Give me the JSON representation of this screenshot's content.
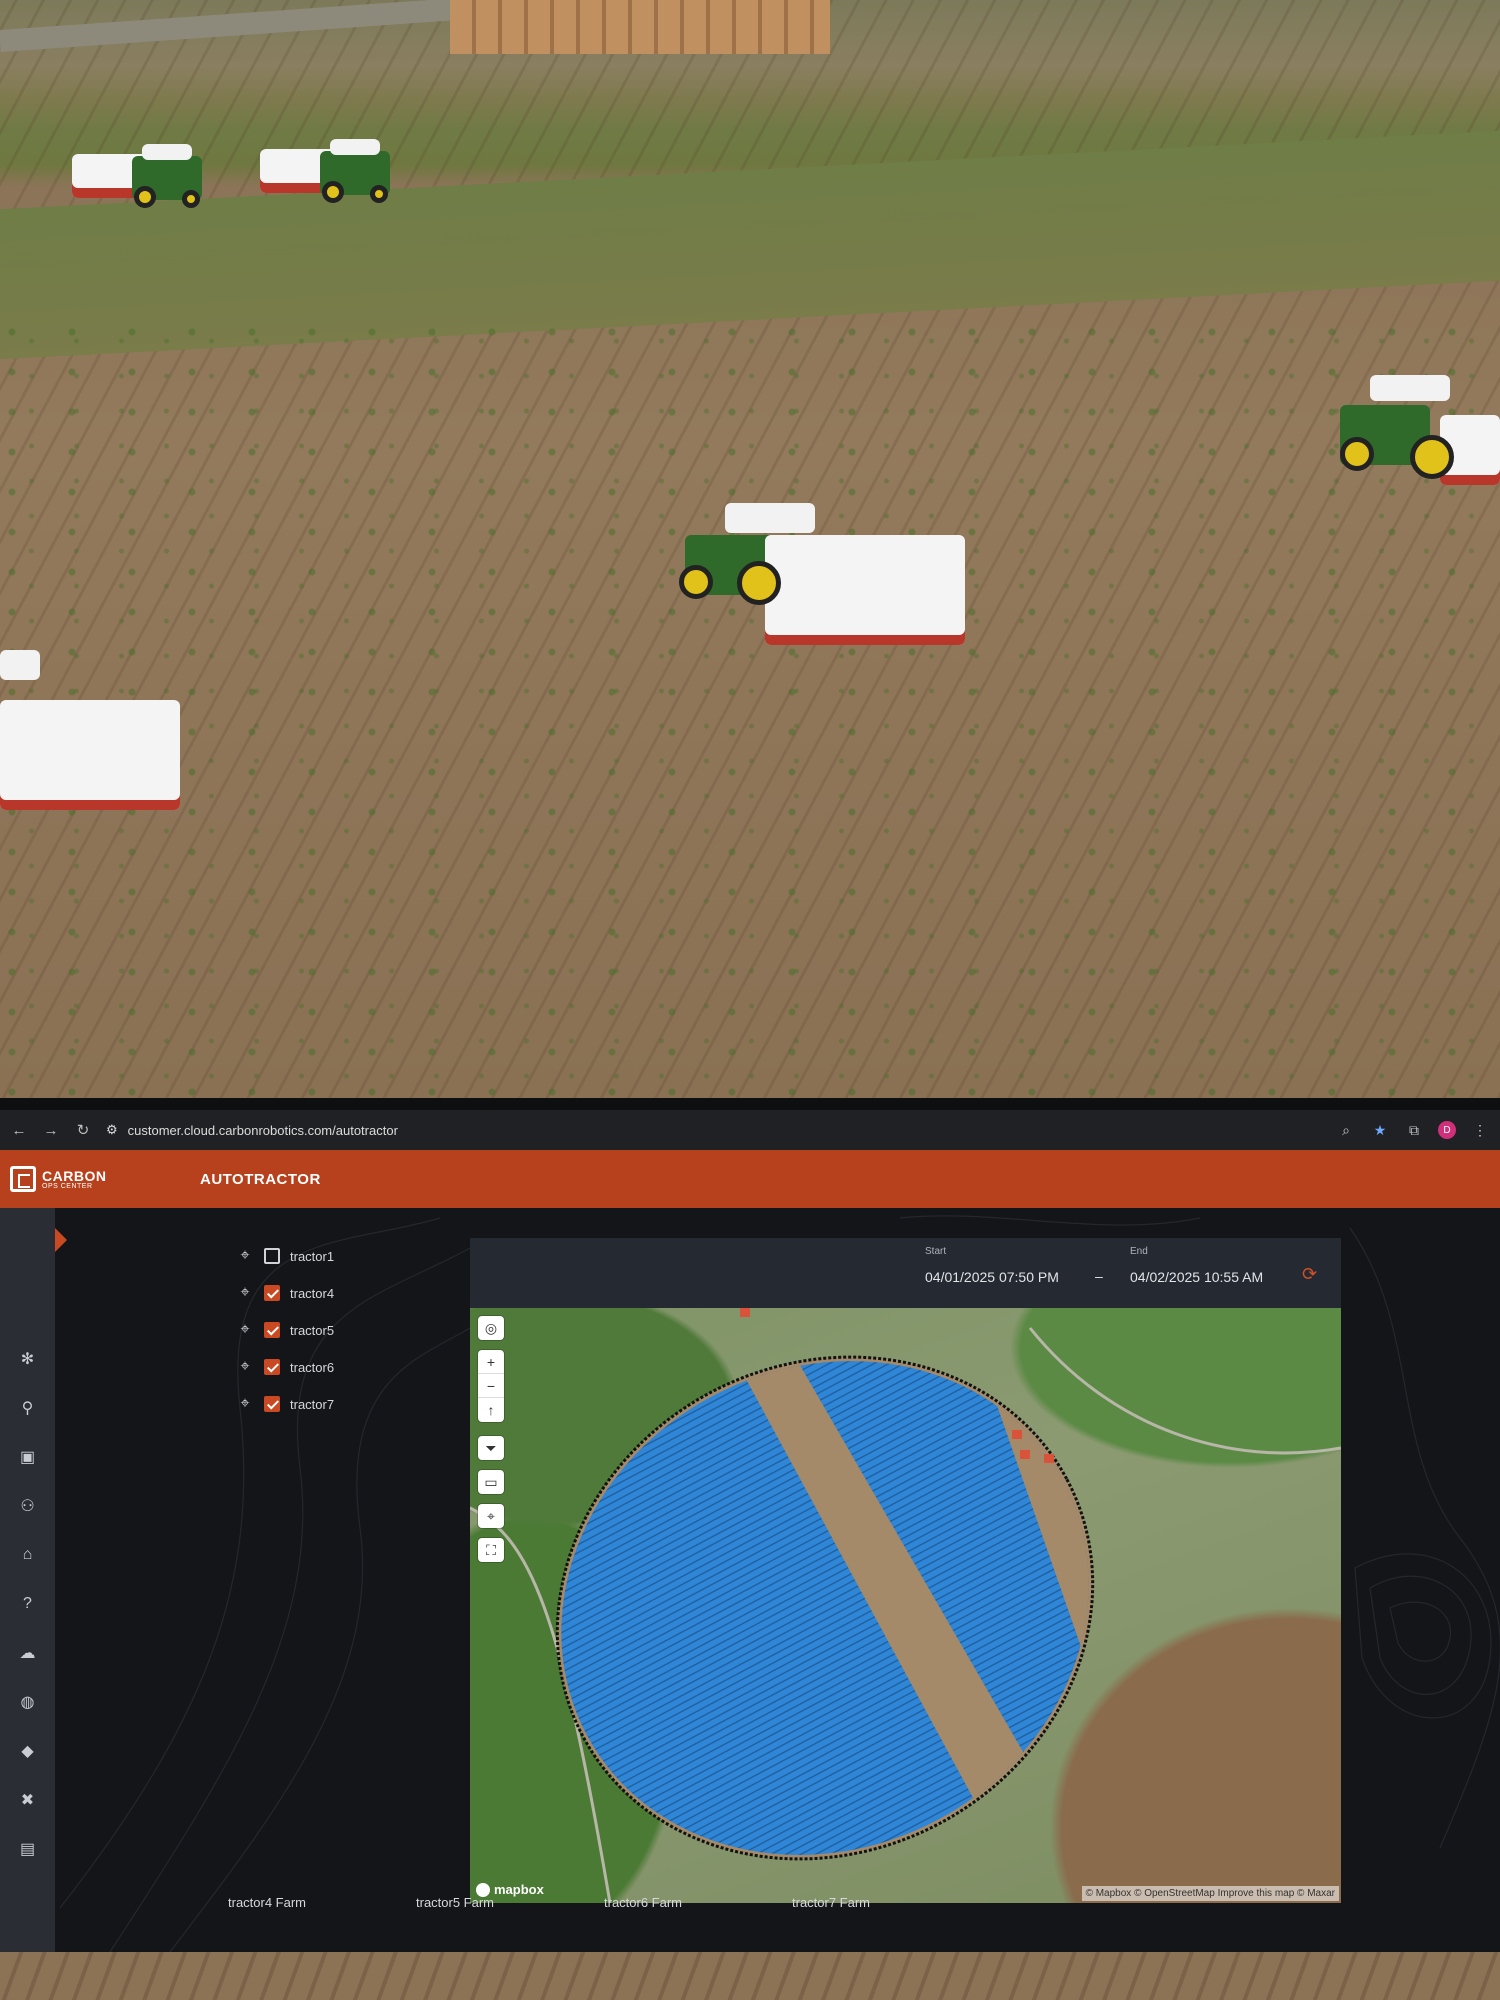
{
  "browser": {
    "url": "customer.cloud.carbonrobotics.com/autotractor",
    "profile_initial": "D"
  },
  "header": {
    "logo_line1": "CARBON",
    "logo_line2": "OPS CENTER",
    "title": "AUTOTRACTOR",
    "color": "#b8411d"
  },
  "sidebar": {
    "icons": [
      "settings-icon",
      "route-icon",
      "image-icon",
      "group-icon",
      "garage-icon",
      "help-icon",
      "cloud-upload-icon",
      "globe-icon",
      "diamond-icon",
      "tools-icon",
      "feedback-icon"
    ]
  },
  "tractors": [
    {
      "label": "tractor1",
      "checked": false
    },
    {
      "label": "tractor4",
      "checked": true
    },
    {
      "label": "tractor5",
      "checked": true
    },
    {
      "label": "tractor6",
      "checked": true
    },
    {
      "label": "tractor7",
      "checked": true
    }
  ],
  "date_range": {
    "start_label": "Start",
    "start_value": "04/01/2025 07:50 PM",
    "separator": "–",
    "end_label": "End",
    "end_value": "04/02/2025 10:55 AM"
  },
  "map": {
    "logo": "mapbox",
    "attribution": "© Mapbox © OpenStreetMap Improve this map © Maxar",
    "path_color": "#2f86d6"
  },
  "farm_tabs": [
    "tractor4 Farm",
    "tractor5 Farm",
    "tractor6 Farm",
    "tractor7 Farm"
  ]
}
